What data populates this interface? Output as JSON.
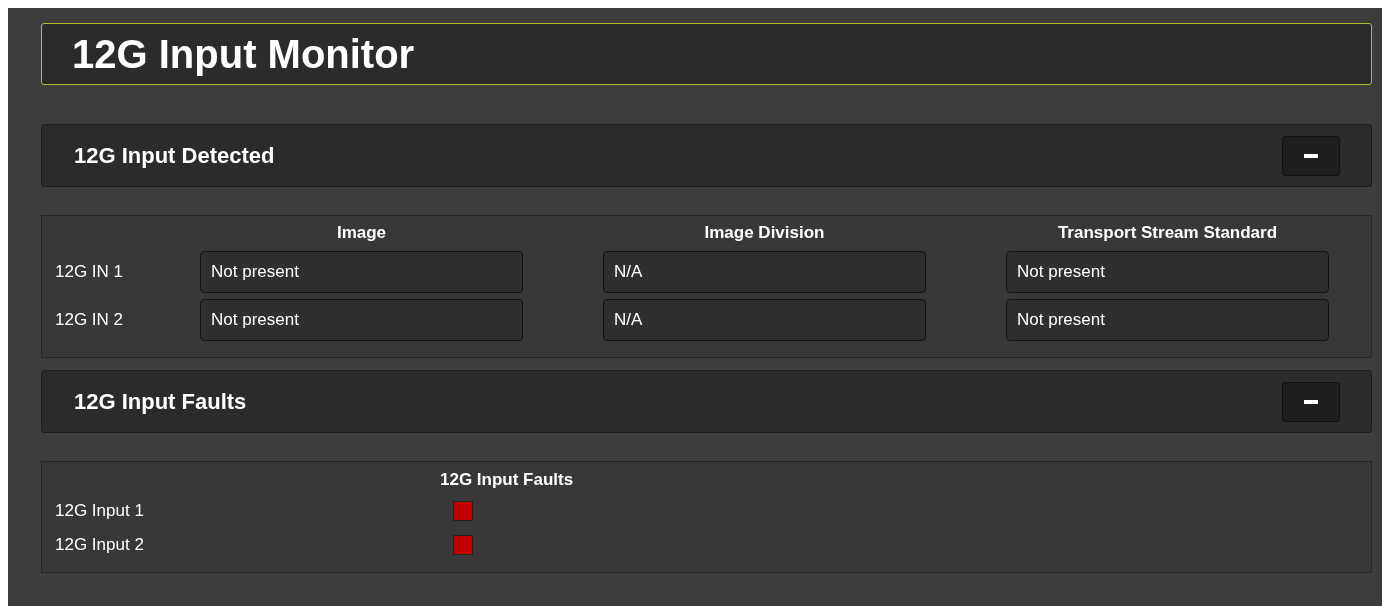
{
  "title": "12G Input Monitor",
  "sections": [
    {
      "kind": "status_table",
      "title": "12G Input Detected",
      "expanded": true,
      "columns": [
        "Image",
        "Image Division",
        "Transport Stream Standard"
      ],
      "rows": [
        {
          "label": "12G IN 1",
          "values": [
            "Not present",
            "N/A",
            "Not present"
          ]
        },
        {
          "label": "12G IN 2",
          "values": [
            "Not present",
            "N/A",
            "Not present"
          ]
        }
      ]
    },
    {
      "kind": "fault_table",
      "title": "12G Input Faults",
      "expanded": true,
      "column": "12G Input Faults",
      "rows": [
        {
          "label": "12G Input 1",
          "fault": true
        },
        {
          "label": "12G Input 2",
          "fault": true
        }
      ]
    }
  ]
}
